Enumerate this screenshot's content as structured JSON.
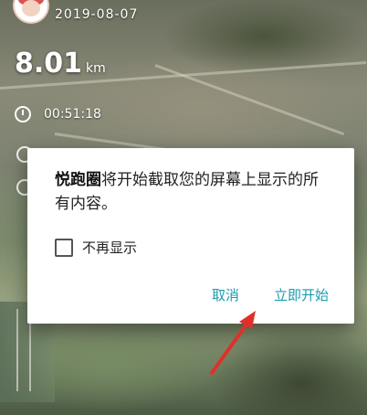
{
  "header": {
    "date": "2019-08-07",
    "distance_value": "8.01",
    "distance_unit": "km",
    "duration": "00:51:18"
  },
  "dialog": {
    "app_name": "悦跑圈",
    "message": "将开始截取您的屏幕上显示的所有内容。",
    "checkbox_label": "不再显示",
    "cancel_label": "取消",
    "start_label": "立即开始"
  },
  "colors": {
    "accent": "#1a9bb0",
    "arrow": "#e0302a"
  },
  "icons": [
    "avatar",
    "clock-icon",
    "red-arrow-annotation"
  ]
}
